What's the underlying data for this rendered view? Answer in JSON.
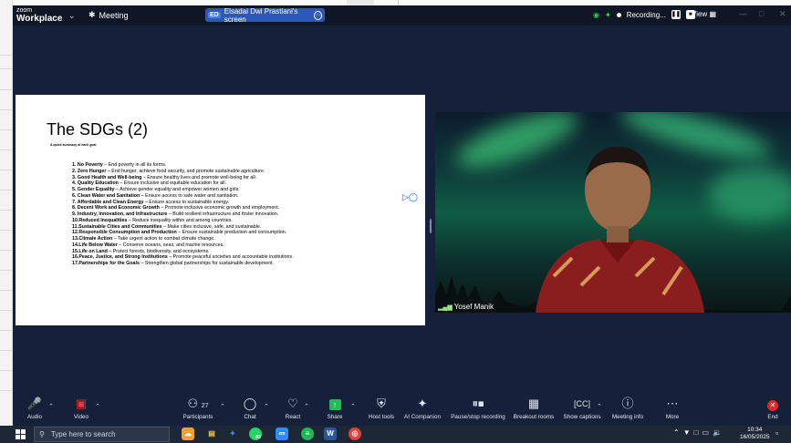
{
  "app": {
    "logo_top": "zoom",
    "logo_bottom": "Workplace",
    "meeting_label": "Meeting"
  },
  "share": {
    "initials": "ED",
    "label": "Elsadai Dwi Prastiani's screen"
  },
  "status": {
    "recording": "Recording...",
    "view": "View"
  },
  "slide": {
    "title": "The SDGs (2)",
    "subtitle": "A quick summary of each goal",
    "goals": [
      {
        "head": "1. No Poverty",
        "body": " – End poverty in all its forms."
      },
      {
        "head": "2. Zero Hunger",
        "body": " – End hunger, achieve food security, and promote sustainable agriculture."
      },
      {
        "head": "3. Good Health and Well-being",
        "body": " – Ensure healthy lives and promote well-being for all."
      },
      {
        "head": "4. Quality Education",
        "body": " – Ensure inclusive and equitable education for all."
      },
      {
        "head": "5. Gender Equality",
        "body": " – Achieve gender equality and empower women and girls."
      },
      {
        "head": "6. Clean Water and Sanitation",
        "body": " – Ensure access to safe water and sanitation."
      },
      {
        "head": "7. Affordable and Clean Energy",
        "body": " – Ensure access to sustainable energy."
      },
      {
        "head": "8. Decent Work and Economic Growth",
        "body": " – Promote inclusive economic growth and employment."
      },
      {
        "head": "9. Industry, Innovation, and Infrastructure",
        "body": " – Build resilient infrastructure and foster innovation."
      },
      {
        "head": "10.Reduced Inequalities",
        "body": " – Reduce inequality within and among countries."
      },
      {
        "head": "11.Sustainable Cities and Communities",
        "body": " – Make cities inclusive, safe, and sustainable."
      },
      {
        "head": "12.Responsible Consumption and Production",
        "body": " – Ensure sustainable production and consumption."
      },
      {
        "head": "13.Climate Action",
        "body": " – Take urgent action to combat climate change."
      },
      {
        "head": "14.Life Below Water",
        "body": " – Conserve oceans, seas, and marine resources."
      },
      {
        "head": "15.Life on Land",
        "body": " – Protect forests, biodiversity, and ecosystems."
      },
      {
        "head": "16.Peace, Justice, and Strong Institutions",
        "body": " – Promote peaceful societies and accountable institutions."
      },
      {
        "head": "17.Partnerships for the Goals",
        "body": " – Strengthen global partnerships for sustainable development."
      }
    ]
  },
  "video": {
    "participant_name": "Yosef Manik"
  },
  "toolbar": {
    "audio": "Audio",
    "video": "Video",
    "participants": "Participants",
    "participant_count": "27",
    "chat": "Chat",
    "react": "React",
    "share": "Share",
    "host_tools": "Host tools",
    "ai_companion": "AI Companion",
    "pause_recording": "Pause/stop recording",
    "breakout": "Breakout rooms",
    "captions": "Show captions",
    "meeting_info": "Meeting info",
    "more": "More",
    "end": "End"
  },
  "taskbar": {
    "search_placeholder": "Type here to search",
    "time": "10:34",
    "date": "16/05/2025",
    "badge": "83"
  },
  "colors": {
    "share_pill": "#2c58b8",
    "share_green": "#1fbd55",
    "end_red": "#e02828",
    "titlebar": "#0f1626",
    "meeting_bg": "#15203a"
  }
}
